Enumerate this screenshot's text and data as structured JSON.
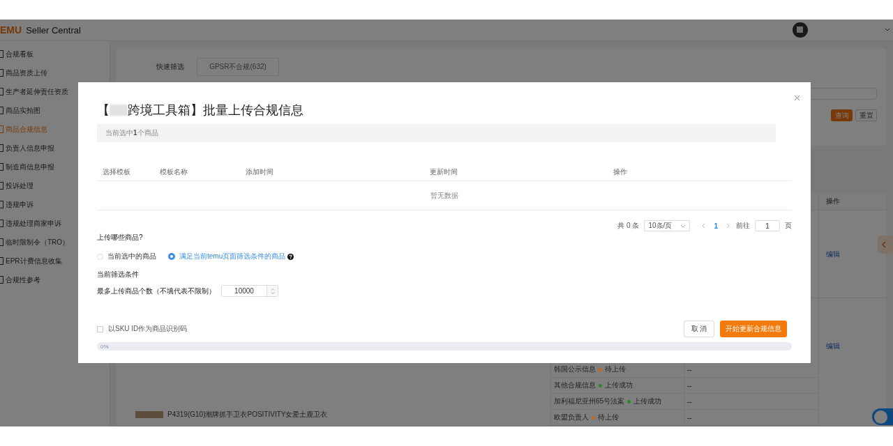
{
  "header": {
    "logo": "EMU",
    "title": "Seller Central"
  },
  "sidebar": {
    "items": [
      {
        "label": "合规看板",
        "selected": false
      },
      {
        "label": "商品资质上传",
        "selected": false
      },
      {
        "label": "生产者延伸责任资质",
        "selected": false
      },
      {
        "label": "商品实拍图",
        "selected": false
      },
      {
        "label": "商品合规信息",
        "selected": true
      },
      {
        "label": "负责人信息申报",
        "selected": false
      },
      {
        "label": "制造商信息申报",
        "selected": false
      },
      {
        "label": "投诉处理",
        "selected": false
      },
      {
        "label": "违规申诉",
        "selected": false
      },
      {
        "label": "违规处理商家申诉",
        "selected": false
      },
      {
        "label": "临时限制令（TRO）",
        "selected": false
      },
      {
        "label": "EPR计费信息收集",
        "selected": false
      },
      {
        "label": "合规性参考",
        "selected": false
      }
    ]
  },
  "filter": {
    "label": "快速筛选",
    "chips": [
      {
        "label": "GPSR不合规(632)"
      }
    ],
    "buttons": [
      {
        "label": "查询",
        "kind": "primary"
      },
      {
        "label": "重置",
        "kind": "default"
      }
    ]
  },
  "table": {
    "columns": [
      {
        "label": "操作"
      }
    ],
    "groups": [
      {
        "action": "编辑"
      },
      {
        "action": "编辑",
        "statuses": [
          {
            "name": "韩国公示信息",
            "status": "待上传",
            "color": "#c8661a",
            "value": "--"
          },
          {
            "name": "其他合规信息",
            "status": "上传成功",
            "color": "#2a8a2a",
            "value": "--"
          },
          {
            "name": "加利福尼亚州65号法案",
            "status": "上传成功",
            "color": "#2a8a2a",
            "value": "--"
          },
          {
            "name": "欧盟负责人",
            "status": "待上传",
            "color": "#c8661a",
            "value": "--"
          }
        ],
        "product": "P4319(G10)潮牌抓手卫衣POSITIVITY女爱土鹿卫衣"
      }
    ]
  },
  "modal": {
    "title_prefix": "【",
    "title": "跨境工具箱】批量上传合规信息",
    "selection_note": "当前选中**1**个商品",
    "columns": [
      {
        "label": "选择模板"
      },
      {
        "label": "模板名称"
      },
      {
        "label": "添加时间"
      },
      {
        "label": "更新时间"
      },
      {
        "label": "操作"
      }
    ],
    "empty_text": "暂无数据",
    "pagination": {
      "total": "共 0 条",
      "page_size": "10条/页",
      "pages": [
        {
          "label": "1",
          "selected": true
        }
      ],
      "goto_label": "前往",
      "goto_value": "1",
      "page_unit": "页"
    },
    "question": "上传哪些商品?",
    "options": [
      {
        "label": "当前选中的商品",
        "selected": false,
        "help": false
      },
      {
        "label": "满足当前temu页面筛选条件的商品",
        "selected": true,
        "help": true
      }
    ],
    "filter_heading": "当前筛选条件",
    "limit": {
      "label": "最多上传商品个数（不填代表不限制）",
      "value": "10000"
    },
    "sku_checkbox": {
      "label": "以SKU ID作为商品识别码",
      "checked": false
    },
    "buttons": [
      {
        "label": "取 消",
        "kind": "default"
      },
      {
        "label": "开始更新合规信息",
        "kind": "primary"
      }
    ],
    "progress": {
      "level": 0,
      "reading": "0%"
    }
  }
}
